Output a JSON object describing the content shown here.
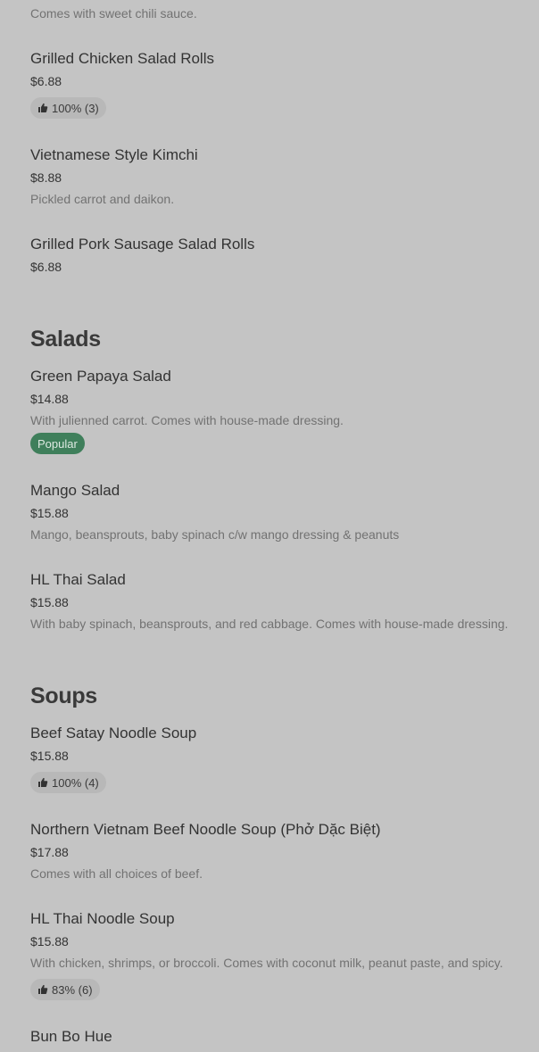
{
  "top_desc": "Comes with sweet chili sauce.",
  "appetizers": [
    {
      "name": "Grilled Chicken Salad Rolls",
      "price": "$6.88",
      "rating": "100% (3)"
    },
    {
      "name": "Vietnamese Style Kimchi",
      "price": "$8.88",
      "desc": "Pickled carrot and daikon."
    },
    {
      "name": "Grilled Pork Sausage Salad Rolls",
      "price": "$6.88"
    }
  ],
  "salads": {
    "title": "Salads",
    "items": [
      {
        "name": "Green Papaya Salad",
        "price": "$14.88",
        "desc": "With julienned carrot. Comes with house-made dressing.",
        "badge": "Popular"
      },
      {
        "name": "Mango Salad",
        "price": "$15.88",
        "desc": "Mango, beansprouts, baby spinach c/w mango dressing & peanuts"
      },
      {
        "name": "HL Thai Salad",
        "price": "$15.88",
        "desc": "With baby spinach, beansprouts, and red cabbage. Comes with house-made dressing."
      }
    ]
  },
  "soups": {
    "title": "Soups",
    "items": [
      {
        "name": "Beef Satay Noodle Soup",
        "price": "$15.88",
        "rating": "100% (4)"
      },
      {
        "name": "Northern Vietnam Beef Noodle Soup (Phở Dặc Biệt)",
        "price": "$17.88",
        "desc": "Comes with all choices of beef."
      },
      {
        "name": "HL Thai Noodle Soup",
        "price": "$15.88",
        "desc": "With chicken, shrimps, or broccoli. Comes with coconut milk, peanut paste, and spicy.",
        "rating": "83% (6)"
      },
      {
        "name": "Bun Bo Hue"
      }
    ]
  },
  "colors": {
    "background": "#c4c4c4",
    "popular_badge": "#3f7f5b"
  },
  "icons": {
    "rating": "thumbs-up-icon"
  }
}
